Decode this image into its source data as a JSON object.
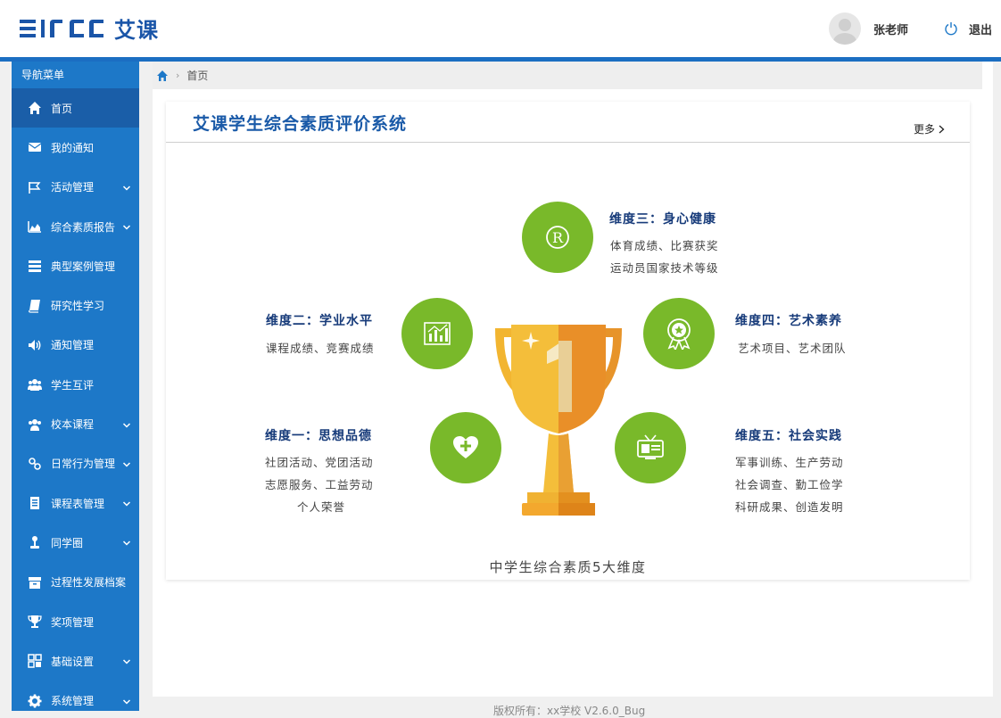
{
  "header": {
    "logo_text": "艾课",
    "user_name": "张老师",
    "logout_label": "退出"
  },
  "sidebar": {
    "title": "导航菜单",
    "items": [
      {
        "label": "首页",
        "icon": "home-icon",
        "active": true,
        "expandable": false
      },
      {
        "label": "我的通知",
        "icon": "envelope-icon",
        "expandable": false
      },
      {
        "label": "活动管理",
        "icon": "flag-icon",
        "expandable": true
      },
      {
        "label": "综合素质报告",
        "icon": "area-chart-icon",
        "expandable": true
      },
      {
        "label": "典型案例管理",
        "icon": "list-icon",
        "expandable": false
      },
      {
        "label": "研究性学习",
        "icon": "book-icon",
        "expandable": false
      },
      {
        "label": "通知管理",
        "icon": "speaker-icon",
        "expandable": false
      },
      {
        "label": "学生互评",
        "icon": "users-icon",
        "expandable": false
      },
      {
        "label": "校本课程",
        "icon": "group-icon",
        "expandable": true
      },
      {
        "label": "日常行为管理",
        "icon": "link-icon",
        "expandable": true
      },
      {
        "label": "课程表管理",
        "icon": "table-icon",
        "expandable": true
      },
      {
        "label": "同学圈",
        "icon": "joystick-icon",
        "expandable": true
      },
      {
        "label": "过程性发展档案",
        "icon": "archive-icon",
        "expandable": false
      },
      {
        "label": "奖项管理",
        "icon": "trophy-icon",
        "expandable": false
      },
      {
        "label": "基础设置",
        "icon": "grid-icon",
        "expandable": true
      },
      {
        "label": "系统管理",
        "icon": "gear-icon",
        "expandable": true
      }
    ]
  },
  "breadcrumb": {
    "current": "首页"
  },
  "card": {
    "title": "艾课学生综合素质评价系统",
    "more_label": "更多"
  },
  "dimensions": [
    {
      "title": "维度三：身心健康",
      "lines": [
        "体育成绩、比赛获奖",
        "运动员国家技术等级"
      ],
      "icon": "registered-icon"
    },
    {
      "title": "维度二：学业水平",
      "lines": [
        "课程成绩、竞赛成绩"
      ],
      "icon": "bar-chart-icon"
    },
    {
      "title": "维度四：艺术素养",
      "lines": [
        "艺术项目、艺术团队"
      ],
      "icon": "medal-icon"
    },
    {
      "title": "维度一：思想品德",
      "lines": [
        "社团活动、党团活动",
        "志愿服务、工益劳动",
        "个人荣誉"
      ],
      "icon": "heart-plus-icon"
    },
    {
      "title": "维度五：社会实践",
      "lines": [
        "军事训练、生产劳动",
        "社会调查、勤工俭学",
        "科研成果、创造发明"
      ],
      "icon": "news-tv-icon"
    }
  ],
  "caption": "中学生综合素质5大维度",
  "footer": "版权所有：xx学校 V2.6.0_Bug",
  "colors": {
    "brand": "#1d78c8",
    "brand_dark": "#1a5ea8",
    "accent_green": "#79b92a",
    "title_navy": "#173b7a"
  }
}
